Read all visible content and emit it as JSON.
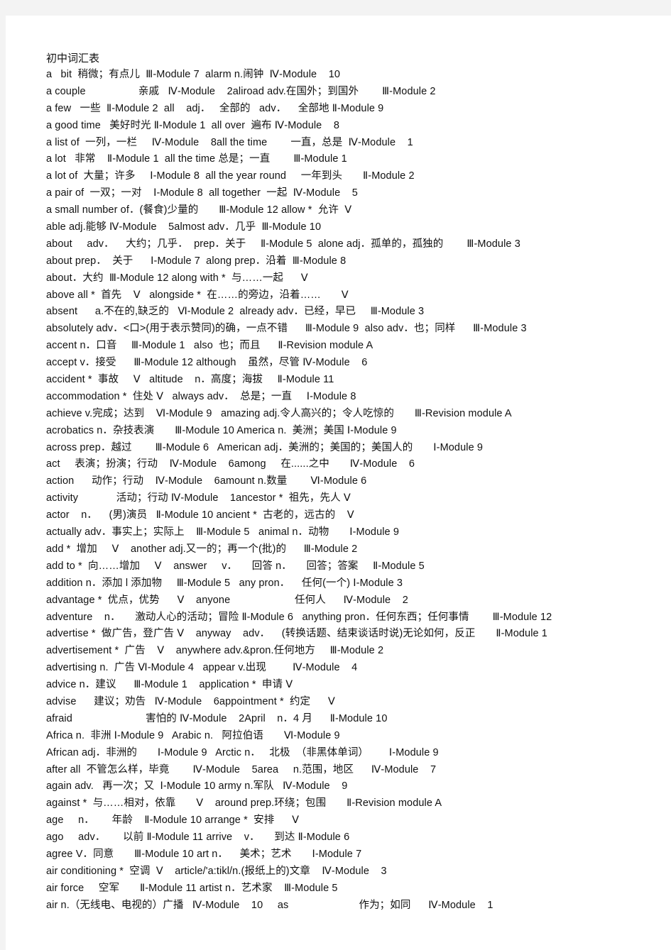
{
  "document": {
    "title": "初中词汇表",
    "lines": [
      "a   bit  稍微；有点儿  Ⅲ-Module 7  alarm n.闹钟  Ⅳ-Module    10",
      "a couple                  亲戚   Ⅳ-Module    2aliroad adv.在国外；到国外        Ⅲ-Module 2",
      "a few   一些  Ⅱ-Module 2  all    adj．   全部的   adv．    全部地 Ⅱ-Module 9",
      "a good time   美好时光 Ⅱ-Module 1  all over  遍布 Ⅳ-Module    8",
      "a list of  一列，一栏     Ⅳ-Module    8all the time        一直，总是  Ⅳ-Module    1",
      "a lot   非常    Ⅱ-Module 1  all the time 总是；一直        Ⅲ-Module 1",
      "a lot of  大量；许多     Ⅰ-Module 8  all the year round     一年到头       Ⅱ-Module 2",
      "a pair of  一双；一对    Ⅰ-Module 8  all together  一起  Ⅳ-Module    5",
      "a small number of．(餐食)少量的       Ⅲ-Module 12 allow *  允许  Ⅴ",
      "able adj.能够 Ⅳ-Module    5almost adv．几乎  Ⅲ-Module 10",
      "about     adv．    大约；几乎．  prep．关于     Ⅱ-Module 5  alone adj．孤单的，孤独的        Ⅲ-Module 3",
      "about prep．  关于      Ⅰ-Module 7  along prep．沿着  Ⅲ-Module 8",
      "about．大约  Ⅲ-Module 12 along with *  与……一起      Ⅴ",
      "above all *  首先    Ⅴ   alongside *  在……的旁边，沿着……       Ⅴ",
      "absent      a.不在的,缺乏的   Ⅵ-Module 2  already adv．已经，早已     Ⅲ-Module 3",
      "absolutely adv．<口>(用于表示赞同)的确，一点不错      Ⅲ-Module 9  also adv．也；同样      Ⅲ-Module 3",
      "accent n．口音     Ⅲ-Module 1   also  也；而且      Ⅱ-Revision module A",
      "accept v．接受      Ⅲ-Module 12 although    虽然，尽管 Ⅳ-Module    6",
      "accident *  事故     Ⅴ   altitude    n．高度；海拔     Ⅱ-Module 11",
      "accommodation *  住处 Ⅴ   always adv．  总是；一直     Ⅰ-Module 8",
      "achieve v.完成；达到    Ⅵ-Module 9   amazing adj.令人高兴的；令人吃惊的       Ⅲ-Revision module A",
      "acrobatics n．杂技表演       Ⅲ-Module 10 America n.  美洲；美国 Ⅰ-Module 9",
      "across prep．越过        Ⅲ-Module 6   American adj．美洲的；美国的；美国人的       Ⅰ-Module 9",
      "act     表演；扮演；行动    Ⅳ-Module    6among     在......之中       Ⅳ-Module    6",
      "action      动作；行动    Ⅳ-Module    6amount n.数量        Ⅵ-Module 6",
      "activity             活动；行动 Ⅳ-Module    1ancestor *  祖先，先人 Ⅴ",
      "actor    n．    (男)演员   Ⅱ-Module 10 ancient *  古老的，远古的    Ⅴ",
      "actually adv．事实上；实际上    Ⅲ-Module 5   animal n．动物       Ⅰ-Module 9",
      "add *  增加     Ⅴ    another adj.又一的；再一个(批)的      Ⅲ-Module 2",
      "add to *  向……增加     Ⅴ    answer     v．     回答 n．     回答；答案     Ⅱ-Module 5",
      "addition n．添加 l 添加物     Ⅲ-Module 5   any pron．    任何(一个) Ⅰ-Module 3",
      "advantage *  优点，优势      Ⅴ    anyone                      任何人      Ⅳ-Module    2",
      "adventure    n．     激动人心的活动；冒险 Ⅱ-Module 6   anything pron．任何东西；任何事情        Ⅲ-Module 12",
      "advertise *  做广告，登广告 Ⅴ    anyway    adv．    (转换话题、结束谈话时说)无论如何，反正       Ⅱ-Module 1",
      "advertisement *  广告    Ⅴ    anywhere adv.&pron.任何地方     Ⅲ-Module 2",
      "advertising n.  广告 Ⅵ-Module 4   appear v.出现         Ⅳ-Module    4",
      "advice n．建议      Ⅲ-Module 1    application *  申请 Ⅴ",
      "advise      建议；劝告   Ⅳ-Module    6appointment *  约定      Ⅴ",
      "afraid                         害怕的 Ⅳ-Module    2April    n．4 月      Ⅱ-Module 10",
      "Africa n.  非洲 Ⅰ-Module 9   Arabic n.   阿拉伯语       Ⅵ-Module 9",
      "African adj．非洲的       Ⅰ-Module 9   Arctic n．   北极  （非黑体单词）       Ⅰ-Module 9",
      "after all  不管怎么样，毕竟        Ⅳ-Module    5area     n.范围，地区      Ⅳ-Module    7",
      "again adv.   再一次；又  Ⅰ-Module 10 army n.军队   Ⅳ-Module    9",
      "against *  与……相对，依靠       Ⅴ    around prep.环绕；包围       Ⅱ-Revision module A",
      "age     n．      年龄    Ⅱ-Module 10 arrange *  安排      Ⅴ",
      "ago     adv．      以前 Ⅱ-Module 11 arrive    v．     到达 Ⅱ-Module 6",
      "agree V．同意       Ⅲ-Module 10 art n．    美术；艺术       Ⅰ-Module 7",
      "air conditioning *  空调  Ⅴ    article/'a:tikl/n.(报纸上的)文章    Ⅳ-Module    3",
      "air force     空军       Ⅱ-Module 11 artist n．艺术家    Ⅲ-Module 5",
      "air n.（无线电、电视的）广播   Ⅳ-Module    10     as                        作为；如同      Ⅳ-Module    1"
    ]
  }
}
